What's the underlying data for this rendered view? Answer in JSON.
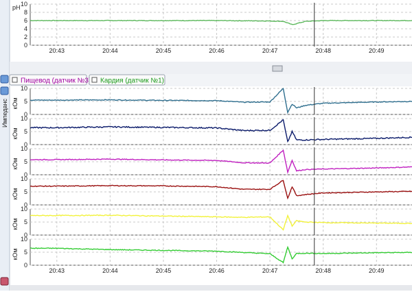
{
  "top_panel": {
    "ylabel": "pH",
    "yticks": [
      "10",
      "8",
      "6",
      "4",
      "2",
      "0"
    ]
  },
  "tabs": [
    {
      "label": "Пищевод (датчик №3)",
      "color": "#a000a0"
    },
    {
      "label": "Кардия (датчик №1)",
      "color": "#1a9a1a"
    }
  ],
  "side_label": "Импеданс",
  "channel_unit": "кОм",
  "channel_yticks": [
    "10",
    "5",
    "0"
  ],
  "time_labels": [
    "20:43",
    "20:44",
    "20:45",
    "20:46",
    "20:47",
    "20:48",
    "20:49"
  ],
  "colors": {
    "ph": "#5cb85c",
    "ch1": "#2e6e8e",
    "ch2": "#0a1a6a",
    "ch3": "#c020c0",
    "ch4": "#9a1010",
    "ch5": "#f2f23a",
    "ch6": "#33cc33",
    "marker": "#333333"
  },
  "chart_data": [
    {
      "type": "line",
      "ylabel": "pH",
      "ylim": [
        0,
        10
      ],
      "x": [
        "20:42:30",
        "20:43:00",
        "20:44:00",
        "20:45:00",
        "20:46:00",
        "20:47:00",
        "20:47:15",
        "20:47:25",
        "20:47:40",
        "20:48:00",
        "20:49:00",
        "20:49:40"
      ],
      "series": [
        {
          "values": [
            6.0,
            6.0,
            6.0,
            6.0,
            6.0,
            5.9,
            5.8,
            5.0,
            5.8,
            6.0,
            6.0,
            6.0
          ]
        }
      ],
      "markers": [
        "20:47:50"
      ],
      "grid": true
    },
    {
      "type": "line",
      "ylabel": "кОм",
      "ylim": [
        0,
        10
      ],
      "x": [
        "20:42:30",
        "20:43:00",
        "20:44:00",
        "20:45:00",
        "20:46:00",
        "20:46:30",
        "20:47:00",
        "20:47:15",
        "20:47:20",
        "20:47:25",
        "20:47:30",
        "20:47:40",
        "20:48:00",
        "20:49:00",
        "20:49:40"
      ],
      "series": [
        {
          "values": [
            5.5,
            5.5,
            5.6,
            5.4,
            5.3,
            4.7,
            4.8,
            10.0,
            0.8,
            4.0,
            2.5,
            3.5,
            4.3,
            4.8,
            5.0
          ]
        },
        {
          "values": [
            6.5,
            6.5,
            6.8,
            6.6,
            6.4,
            5.4,
            5.5,
            9.5,
            1.0,
            5.0,
            1.8,
            1.8,
            2.0,
            2.4,
            2.8
          ]
        },
        {
          "values": [
            5.8,
            5.8,
            6.0,
            5.7,
            5.5,
            4.6,
            4.5,
            9.5,
            1.0,
            5.5,
            1.5,
            2.0,
            2.2,
            2.6,
            3.0
          ]
        },
        {
          "values": [
            7.2,
            7.2,
            7.4,
            7.3,
            7.0,
            6.0,
            6.0,
            9.5,
            2.5,
            7.0,
            3.5,
            4.0,
            4.6,
            5.0,
            5.2
          ]
        },
        {
          "values": [
            7.5,
            7.5,
            7.6,
            7.3,
            7.0,
            6.8,
            7.0,
            2.0,
            7.5,
            3.5,
            5.5,
            5.0,
            4.8,
            4.6,
            4.5
          ]
        },
        {
          "values": [
            6.5,
            6.5,
            6.0,
            5.7,
            5.4,
            4.9,
            4.4,
            1.0,
            7.0,
            2.5,
            4.5,
            4.6,
            4.5,
            4.8,
            4.9
          ]
        }
      ],
      "markers": [
        "20:47:50"
      ],
      "grid": true
    }
  ]
}
